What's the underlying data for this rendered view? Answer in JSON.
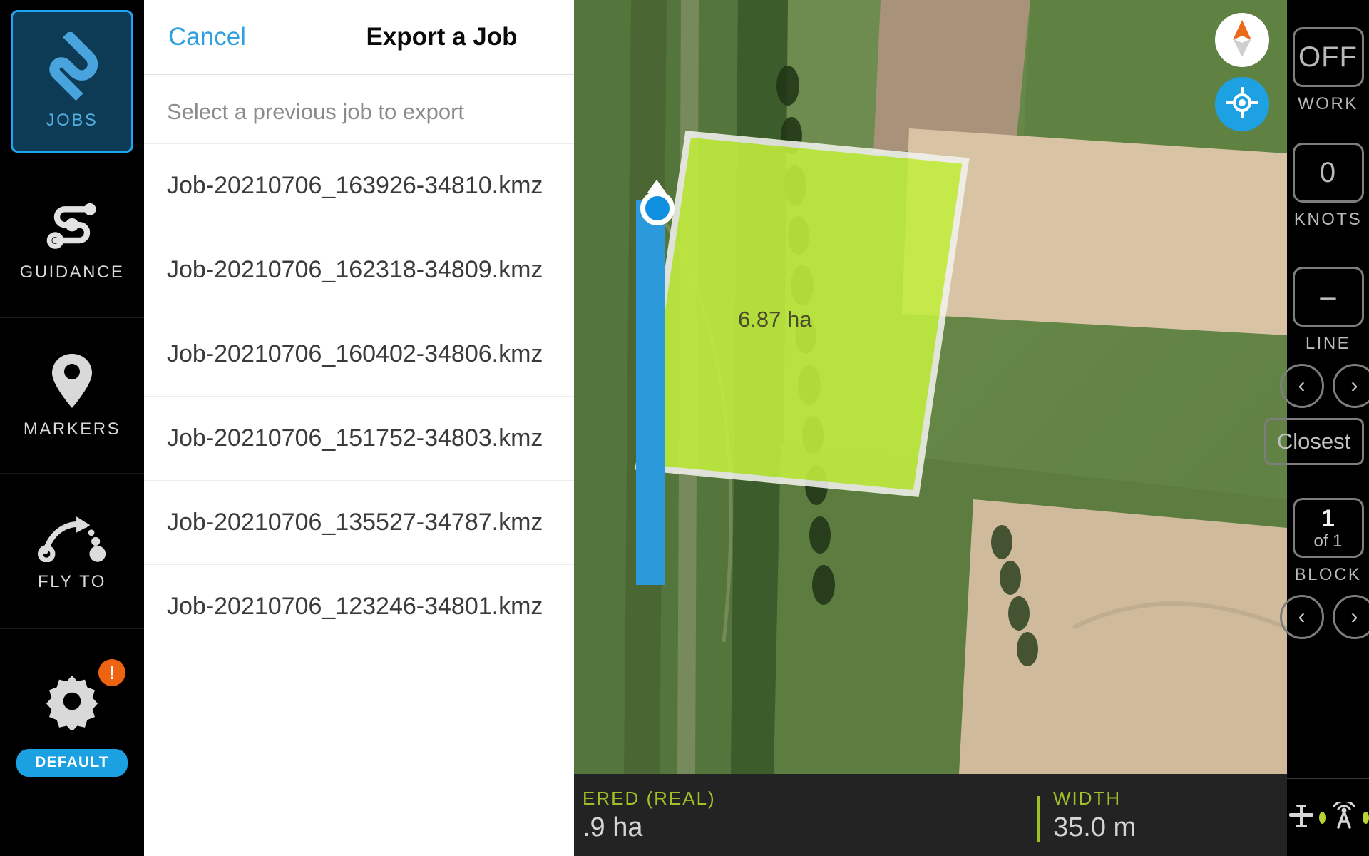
{
  "sidebar": {
    "items": [
      {
        "label": "JOBS",
        "icon": "jobs-icon",
        "active": true
      },
      {
        "label": "GUIDANCE",
        "icon": "guidance-icon",
        "active": false
      },
      {
        "label": "MARKERS",
        "icon": "marker-pin-icon",
        "active": false
      },
      {
        "label": "FLY TO",
        "icon": "fly-to-icon",
        "active": false
      }
    ],
    "settings": {
      "icon": "gear-icon",
      "alert_badge": "!",
      "profile_label": "DEFAULT",
      "alert_color": "#ee6311",
      "pill_color": "#1ba1e2"
    },
    "active_accent": "#1fa5ef"
  },
  "panel": {
    "cancel_label": "Cancel",
    "title": "Export a Job",
    "subtitle": "Select a previous job to export",
    "jobs": [
      "Job-20210706_163926-34810.kmz",
      "Job-20210706_162318-34809.kmz",
      "Job-20210706_160402-34806.kmz",
      "Job-20210706_151752-34803.kmz",
      "Job-20210706_135527-34787.kmz",
      "Job-20210706_123246-34801.kmz"
    ],
    "cancel_color": "#2f9fe0"
  },
  "map": {
    "field_area_label": "6.87 ha",
    "field_fill_color": "#c4ef3e",
    "track_color": "#2c9ada",
    "compass_icon": "compass-needle-icon",
    "gps_icon": "gps-target-icon"
  },
  "status_bar": {
    "covered": {
      "label": "ERED (REAL)",
      "value": ".9  ha"
    },
    "width": {
      "label": "WIDTH",
      "value": "35.0 m"
    },
    "accent_color": "#9ec127"
  },
  "rail": {
    "work": {
      "value": "OFF",
      "label": "WORK"
    },
    "knots": {
      "value": "0",
      "label": "KNOTS"
    },
    "line": {
      "value": "–",
      "label": "LINE",
      "prev": "‹",
      "next": "›"
    },
    "closest_label": "Closest",
    "block": {
      "value": "1",
      "sub": "of 1",
      "label": "BLOCK",
      "prev": "‹",
      "next": "›"
    },
    "status": {
      "aircraft_icon": "aircraft-icon",
      "aircraft_state_color": "#b7d32e",
      "signal_icon": "antenna-signal-icon",
      "signal_state_color": "#b7d32e"
    }
  }
}
